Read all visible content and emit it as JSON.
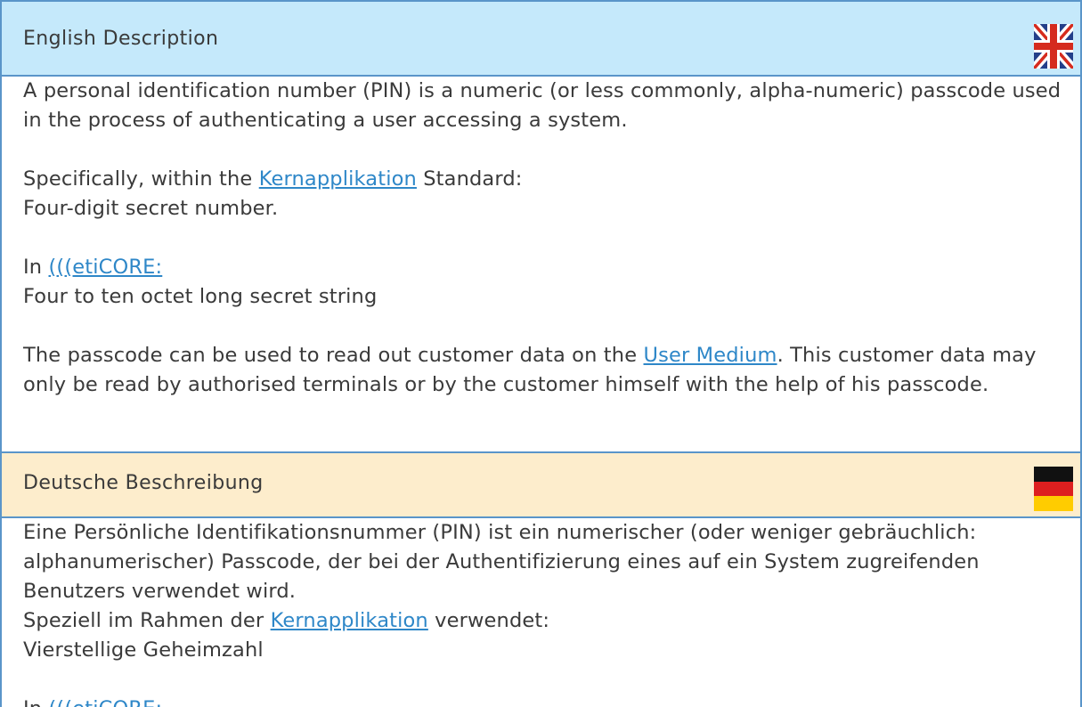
{
  "english": {
    "header": "English Description",
    "flag_icon": "uk-flag-icon",
    "para1": "A personal identification number (PIN) is a numeric (or less commonly, alpha-numeric) passcode used in the process of authenticating a user accessing a system.",
    "para2_prefix": "Specifically, within the ",
    "para2_link": "Kernapplikation",
    "para2_suffix": " Standard:",
    "para2_line2": "Four-digit secret number.",
    "para3_prefix": "In ",
    "para3_link": "(((etiCORE:",
    "para3_line2": "Four to ten octet long secret string",
    "para4_prefix": "The passcode can be used to read out customer data on the ",
    "para4_link": "User Medium",
    "para4_suffix": ". This customer data may only be read by authorised terminals or by the customer himself with the help of his passcode."
  },
  "german": {
    "header": "Deutsche Beschreibung",
    "flag_icon": "german-flag-icon",
    "para1": "Eine Persönliche Identifikationsnummer (PIN) ist ein numerischer (oder weniger gebräuchlich: alphanumerischer) Passcode, der bei der Authentifizierung eines auf ein System zugreifenden Benutzers verwendet wird.",
    "para2_prefix": "Speziell im Rahmen der ",
    "para2_link": "Kernapplikation",
    "para2_suffix": " verwendet:",
    "para2_line2": "Vierstellige Geheimzahl",
    "para3_prefix": "In ",
    "para3_link": "(((etiCORE:"
  },
  "colors": {
    "border": "#5a95c9",
    "english_header_bg": "#c5e9fb",
    "german_header_bg": "#fdedcc",
    "link": "#2e87c8",
    "text": "#3a3a3a"
  }
}
